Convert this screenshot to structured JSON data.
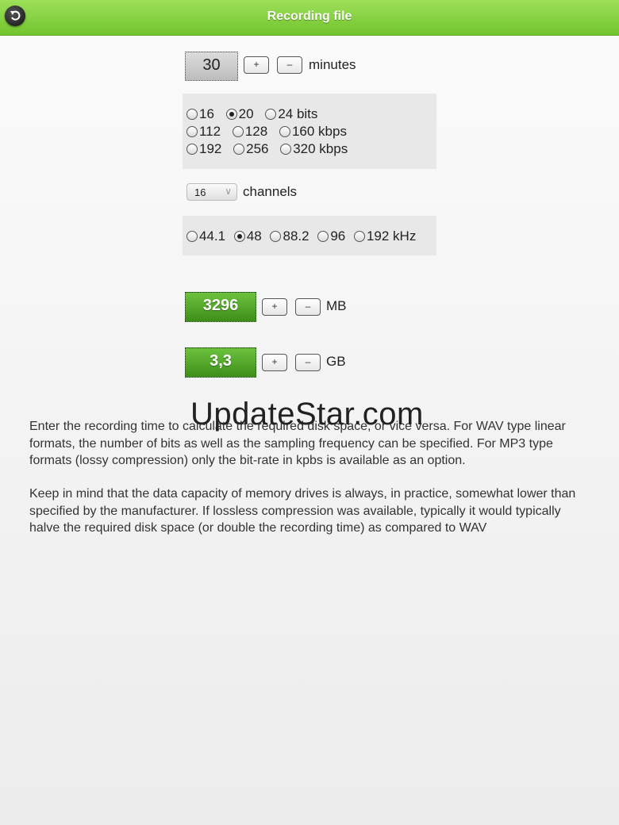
{
  "header": {
    "title": "Recording file",
    "back_icon": "back-arrow-icon"
  },
  "duration": {
    "value": "30",
    "plus": "+",
    "minus": "–",
    "unit": "minutes"
  },
  "bits_panel": {
    "bits": [
      {
        "label": "16",
        "selected": false
      },
      {
        "label": "20",
        "selected": true
      },
      {
        "label": "24 bits",
        "selected": false
      }
    ],
    "kbps_row1": [
      {
        "label": "112",
        "selected": false
      },
      {
        "label": "128",
        "selected": false
      },
      {
        "label": "160 kbps",
        "selected": false
      }
    ],
    "kbps_row2": [
      {
        "label": "192",
        "selected": false
      },
      {
        "label": "256",
        "selected": false
      },
      {
        "label": "320 kbps",
        "selected": false
      }
    ]
  },
  "channels": {
    "selected": "16",
    "label": "channels"
  },
  "khz_panel": {
    "options": [
      {
        "label": "44.1",
        "selected": false
      },
      {
        "label": "48",
        "selected": true
      },
      {
        "label": "88.2",
        "selected": false
      },
      {
        "label": "96",
        "selected": false
      },
      {
        "label": "192 kHz",
        "selected": false
      }
    ]
  },
  "size_mb": {
    "value": "3296",
    "plus": "+",
    "minus": "–",
    "unit": "MB"
  },
  "size_gb": {
    "value": "3,3",
    "plus": "+",
    "minus": "–",
    "unit": "GB"
  },
  "description": {
    "p1": "Enter the recording time to calculate the required disk space, or vice versa. For WAV type linear formats, the number of bits as well as the sampling frequency can be specified. For MP3 type formats (lossy compression) only the bit-rate in kpbs is available as an option.",
    "p2": "Keep in mind that the data capacity of memory drives is always, in practice, somewhat lower than specified by the manufacturer. If lossless compression was available, typically it would typically halve the required disk space (or double the recording time) as compared to WAV"
  },
  "watermark": "UpdateStar.com",
  "colors": {
    "header": "#8ad64a",
    "green_box": "#4fa828"
  }
}
